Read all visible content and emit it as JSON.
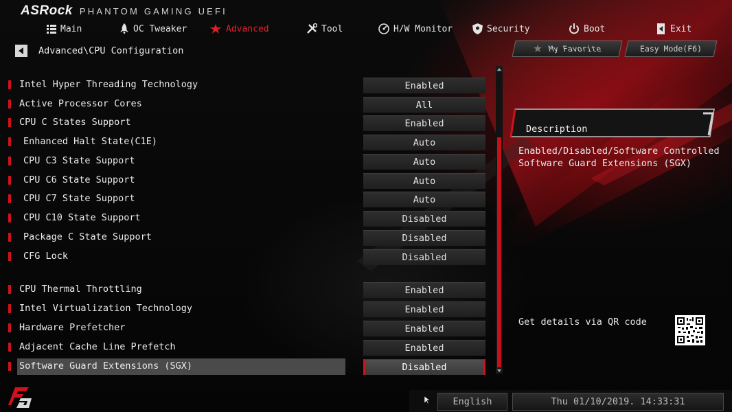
{
  "header": {
    "brand": "ASRock",
    "subtitle": "PHANTOM GAMING UEFI"
  },
  "nav": [
    {
      "label": "Main",
      "icon": "list-icon",
      "active": false
    },
    {
      "label": "OC Tweaker",
      "icon": "rocket-icon",
      "active": false
    },
    {
      "label": "Advanced",
      "icon": "star-icon",
      "active": true
    },
    {
      "label": "Tool",
      "icon": "tools-icon",
      "active": false
    },
    {
      "label": "H/W Monitor",
      "icon": "gauge-icon",
      "active": false
    },
    {
      "label": "Security",
      "icon": "shield-icon",
      "active": false
    },
    {
      "label": "Boot",
      "icon": "power-icon",
      "active": false
    },
    {
      "label": "Exit",
      "icon": "exit-icon",
      "active": false
    }
  ],
  "breadcrumb": "Advanced\\CPU Configuration",
  "buttons": {
    "favorite": "My Favorite",
    "easy_mode": "Easy Mode(F6)"
  },
  "settings": [
    {
      "label": "Intel Hyper Threading Technology",
      "value": "Enabled",
      "indent": false
    },
    {
      "label": "Active Processor Cores",
      "value": "All",
      "indent": false
    },
    {
      "label": "CPU C States Support",
      "value": "Enabled",
      "indent": false
    },
    {
      "label": "Enhanced Halt State(C1E)",
      "value": "Auto",
      "indent": true
    },
    {
      "label": "CPU C3 State Support",
      "value": "Auto",
      "indent": true
    },
    {
      "label": "CPU C6 State Support",
      "value": "Auto",
      "indent": true
    },
    {
      "label": "CPU C7 State Support",
      "value": "Auto",
      "indent": true
    },
    {
      "label": "CPU C10 State Support",
      "value": "Disabled",
      "indent": true
    },
    {
      "label": "Package C State Support",
      "value": "Disabled",
      "indent": true
    },
    {
      "label": "CFG Lock",
      "value": "Disabled",
      "indent": true
    },
    {
      "label": "CPU Thermal Throttling",
      "value": "Enabled",
      "indent": false
    },
    {
      "label": "Intel Virtualization Technology",
      "value": "Enabled",
      "indent": false
    },
    {
      "label": "Hardware Prefetcher",
      "value": "Enabled",
      "indent": false
    },
    {
      "label": "Adjacent Cache Line Prefetch",
      "value": "Enabled",
      "indent": false
    },
    {
      "label": "Software Guard Extensions (SGX)",
      "value": "Disabled",
      "indent": false,
      "selected": true
    }
  ],
  "description": {
    "title": "Description",
    "lines": [
      "Enabled/Disabled/Software Controlled",
      "Software Guard Extensions (SGX)"
    ],
    "qr_label": "Get details via QR code"
  },
  "footer": {
    "language": "English",
    "datetime": "Thu 01/10/2019. 14:33:31"
  },
  "colors": {
    "accent": "#d0121c",
    "background": "#050505",
    "selected_row": "#4a4a4a"
  }
}
